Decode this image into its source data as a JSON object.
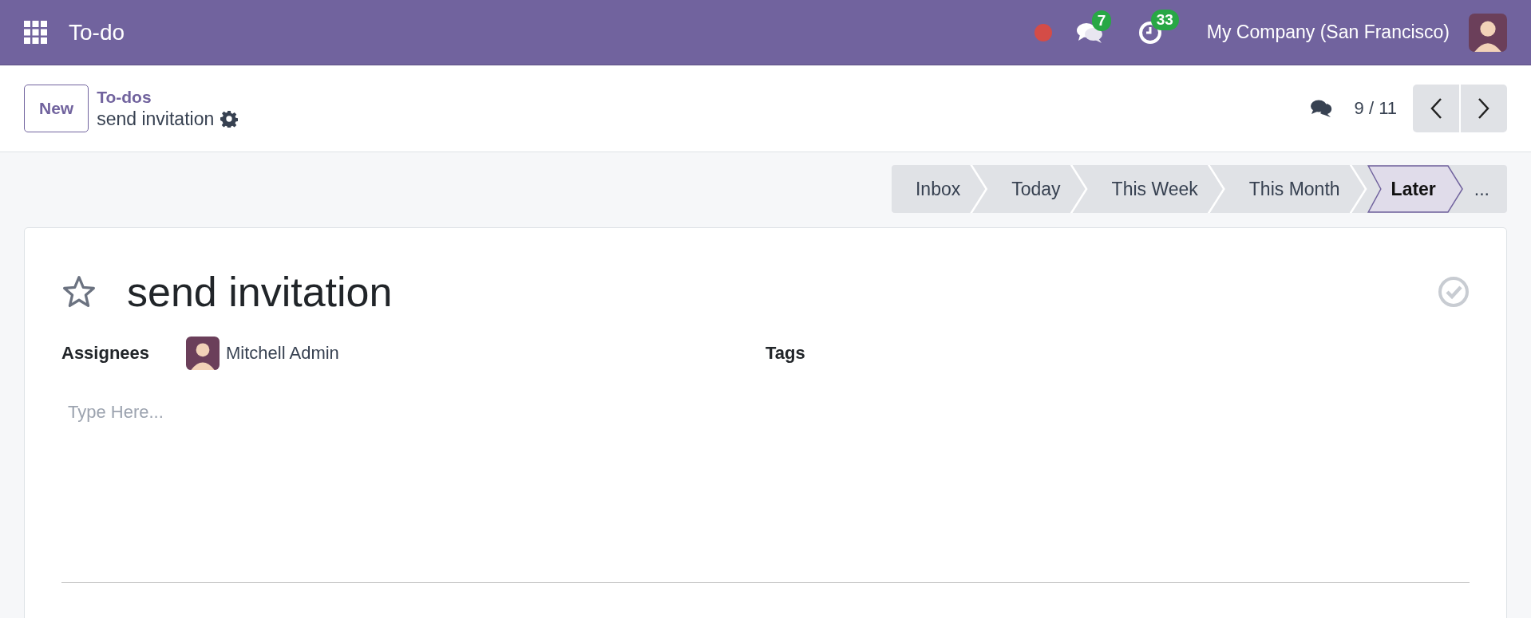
{
  "navbar": {
    "app_name": "To-do",
    "messages_count": "7",
    "activities_count": "33",
    "company": "My Company (San Francisco)"
  },
  "control_panel": {
    "new_button": "New",
    "breadcrumb": "To-dos",
    "record_name": "send invitation",
    "pager": "9 / 11"
  },
  "stages": [
    {
      "label": "Inbox",
      "selected": false
    },
    {
      "label": "Today",
      "selected": false
    },
    {
      "label": "This Week",
      "selected": false
    },
    {
      "label": "This Month",
      "selected": false
    },
    {
      "label": "Later",
      "selected": true
    }
  ],
  "stages_more": "...",
  "form": {
    "title": "send invitation",
    "starred": false,
    "assignees_label": "Assignees",
    "assignee": "Mitchell Admin",
    "tags_label": "Tags",
    "placeholder": "Type Here..."
  }
}
